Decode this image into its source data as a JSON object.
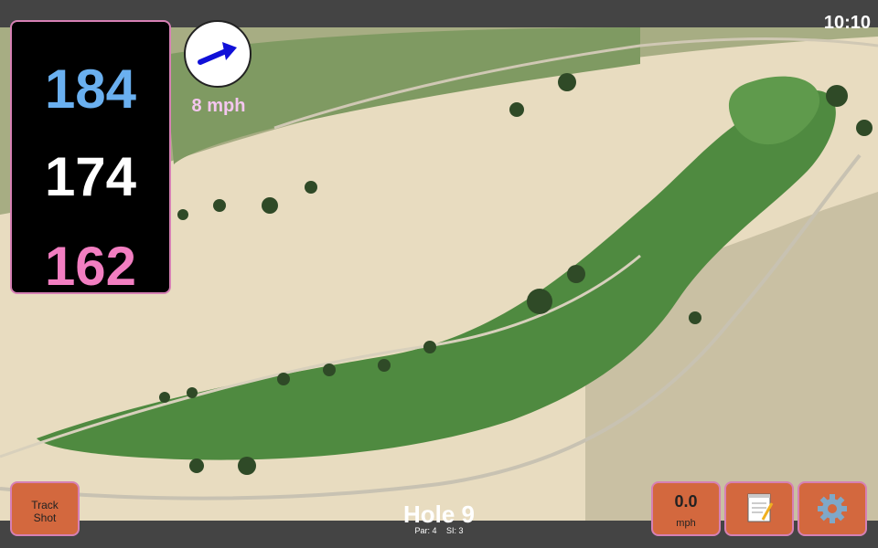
{
  "status": {
    "time": "10:10"
  },
  "distances": {
    "back": "184",
    "middle": "174",
    "front": "162"
  },
  "wind": {
    "speed": "8 mph",
    "icon": "wind-direction-arrow-icon"
  },
  "hole": {
    "title": "Hole 9",
    "par": "Par: 4",
    "si": "SI: 3"
  },
  "buttons": {
    "track_shot_line1": "Track",
    "track_shot_line2": "Shot",
    "speed_value": "0.0",
    "speed_unit": "mph",
    "notes_icon": "notepad-icon",
    "settings_icon": "gear-icon"
  },
  "colors": {
    "back_distance": "#6ab0f0",
    "middle_distance": "#ffffff",
    "front_distance": "#f27ec1",
    "button_bg": "#d3683e",
    "button_border": "#d680b4",
    "wind_arrow": "#1010d8"
  }
}
